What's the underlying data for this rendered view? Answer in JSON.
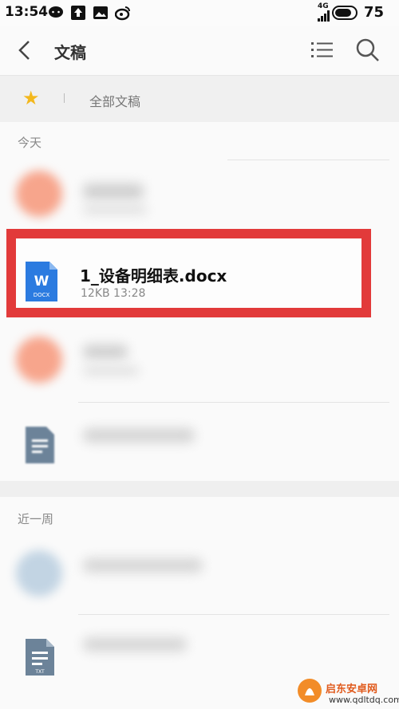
{
  "status_bar": {
    "time": "13:54",
    "network": "4G",
    "battery": "75"
  },
  "header": {
    "title": "文稿"
  },
  "breadcrumb": {
    "label": "全部文稿"
  },
  "sections": {
    "today": "今天",
    "week": "近一周"
  },
  "highlighted_file": {
    "name": "1_设备明细表.docx",
    "meta": "12KB  13:28",
    "icon_type": "W",
    "icon_ext": "DOCX"
  },
  "icons": {
    "txt_label": "TXT"
  },
  "watermark": {
    "brand": "启东安卓网",
    "url": "www.qdltdq.com"
  },
  "colors": {
    "highlight_border": "#e23a3a",
    "docx_blue": "#2b7be0",
    "star": "#f3b81d"
  }
}
